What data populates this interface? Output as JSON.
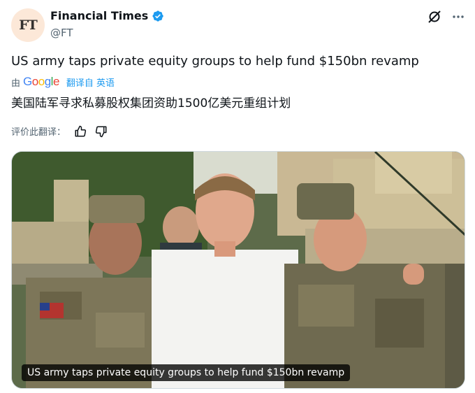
{
  "author": {
    "avatar_text": "FT",
    "name": "Financial Times",
    "handle": "@FT",
    "verified": true,
    "avatar_bg": "#fce8d8"
  },
  "top_icons": [
    "grok-icon",
    "more-icon"
  ],
  "tweet": {
    "text": "US army taps private equity groups to help fund $150bn revamp",
    "translation_prefix": "由",
    "translation_provider": "Google",
    "translation_link": "翻译自 英语",
    "translated_text": "美国陆军寻求私募股权集团资助1500亿美元重组计划"
  },
  "rating": {
    "label": "评价此翻译："
  },
  "media": {
    "caption": "US army taps private equity groups to help fund $150bn revamp"
  },
  "colors": {
    "link": "#1d9bf0",
    "secondary_text": "#536471",
    "verified": "#1d9bf0"
  }
}
